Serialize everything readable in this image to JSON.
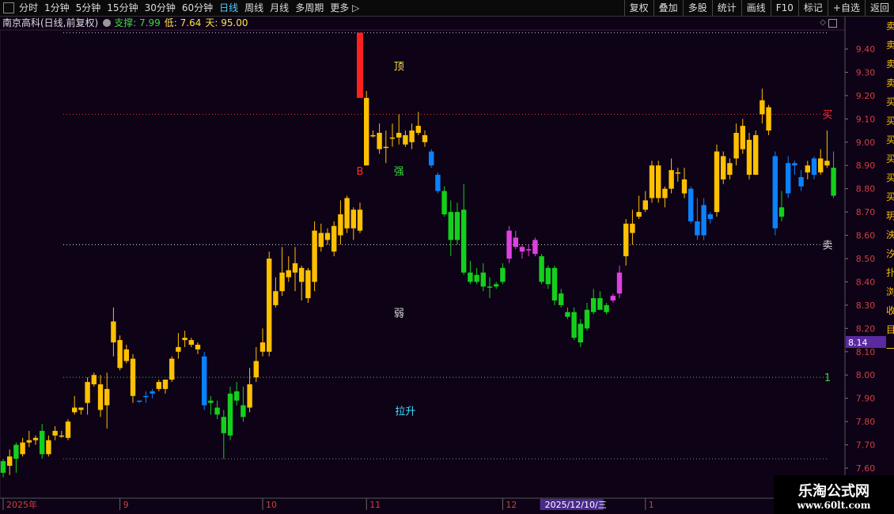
{
  "toolbar": {
    "periods": [
      "分时",
      "1分钟",
      "5分钟",
      "15分钟",
      "30分钟",
      "60分钟",
      "日线",
      "周线",
      "月线",
      "多周期",
      "更多 ▷"
    ],
    "active_index": 6,
    "buttons": [
      "复权",
      "叠加",
      "多股",
      "统计",
      "画线",
      "F10",
      "标记",
      "+自选",
      "返回"
    ]
  },
  "info": {
    "stock_name": "南京高科(日线,前复权)",
    "support": "支撑: 7.99",
    "low": "低: 7.64",
    "days": "天: 95.00"
  },
  "right_strip": [
    "卖",
    "卖",
    "卖",
    "卖",
    "买",
    "买",
    "买",
    "买",
    "买",
    "买",
    "玥",
    "泱",
    "汐",
    "扑",
    "浏",
    "收",
    "目",
    "一"
  ],
  "watermark": {
    "line1": "乐淘公式网",
    "line2": "www.60lt.com"
  },
  "colors": {
    "up": "#ffc000",
    "down": "#14d01c",
    "blue": "#0a82ff",
    "magenta": "#e040e0",
    "red": "#ff2020",
    "bg": "#0d0216"
  },
  "chart_data": {
    "type": "candlestick",
    "ylim": [
      7.55,
      9.47
    ],
    "y_ticks": [
      "9.40",
      "9.30",
      "9.20",
      "9.10",
      "9.00",
      "8.90",
      "8.80",
      "8.70",
      "8.60",
      "8.50",
      "8.40",
      "8.30",
      "8.20",
      "8.10",
      "8.00",
      "7.90",
      "7.80",
      "7.70",
      "7.60"
    ],
    "current_price_label": "8.14",
    "current_price": 8.14,
    "x_labels": [
      {
        "label": "2025年",
        "index": 0
      },
      {
        "label": "9",
        "index": 18
      },
      {
        "label": "10",
        "index": 40
      },
      {
        "label": "11",
        "index": 56
      },
      {
        "label": "12",
        "index": 77
      },
      {
        "label": "2025/12/10/三",
        "index": 83,
        "highlight": true
      },
      {
        "label": "1",
        "index": 99
      },
      {
        "label": "2",
        "index": 119
      }
    ],
    "hlines": [
      {
        "value": 9.47,
        "color": "#cccccc",
        "label": ""
      },
      {
        "value": 9.12,
        "color": "#ff3030",
        "label": "买"
      },
      {
        "value": 8.56,
        "color": "#dddddd",
        "label": "卖"
      },
      {
        "value": 7.99,
        "color": "#40d040",
        "label": "1"
      },
      {
        "value": 7.64,
        "color": "#888888",
        "label": ""
      }
    ],
    "annotations": [
      {
        "text": "顶",
        "index": 61,
        "value": 9.31,
        "color": "#ffe24a"
      },
      {
        "text": "强",
        "index": 61,
        "value": 8.86,
        "color": "#3cdc3c"
      },
      {
        "text": "弱",
        "index": 61,
        "value": 8.25,
        "color": "#dddddd"
      },
      {
        "text": "拉升",
        "index": 62,
        "value": 7.83,
        "color": "#40e0ff"
      },
      {
        "text": "B",
        "index": 55,
        "value": 8.86,
        "color": "#ff3030"
      }
    ],
    "spike": {
      "index": 55,
      "top": 9.47,
      "mid": 9.19,
      "bottom": 8.9
    },
    "candles": [
      [
        7.58,
        7.63,
        7.64,
        7.56,
        "g"
      ],
      [
        7.61,
        7.65,
        7.68,
        7.57,
        "y"
      ],
      [
        7.7,
        7.64,
        7.71,
        7.58,
        "g"
      ],
      [
        7.66,
        7.71,
        7.73,
        7.65,
        "y"
      ],
      [
        7.71,
        7.72,
        7.76,
        7.69,
        "y"
      ],
      [
        7.72,
        7.73,
        7.74,
        7.7,
        "y"
      ],
      [
        7.76,
        7.66,
        7.79,
        7.64,
        "g"
      ],
      [
        7.66,
        7.72,
        7.74,
        7.65,
        "y"
      ],
      [
        7.74,
        7.76,
        7.78,
        7.72,
        "y"
      ],
      [
        7.74,
        7.74,
        7.76,
        7.73,
        "y"
      ],
      [
        7.73,
        7.8,
        7.81,
        7.72,
        "y"
      ],
      [
        7.84,
        7.86,
        7.91,
        7.83,
        "y"
      ],
      [
        7.85,
        7.86,
        7.86,
        7.83,
        "y"
      ],
      [
        7.88,
        7.97,
        7.99,
        7.83,
        "y"
      ],
      [
        7.96,
        8.0,
        8.01,
        7.95,
        "y"
      ],
      [
        7.96,
        7.85,
        8.0,
        7.82,
        "y"
      ],
      [
        7.87,
        7.94,
        8.01,
        7.77,
        "y"
      ],
      [
        8.14,
        8.23,
        8.29,
        8.08,
        "y"
      ],
      [
        8.03,
        8.15,
        8.17,
        8.02,
        "y"
      ],
      [
        8.11,
        8.06,
        8.13,
        8.05,
        "y"
      ],
      [
        8.07,
        7.91,
        8.09,
        7.88,
        "y"
      ],
      [
        7.89,
        7.89,
        7.89,
        7.88,
        "b"
      ],
      [
        7.91,
        7.91,
        7.93,
        7.88,
        "b"
      ],
      [
        7.92,
        7.93,
        7.94,
        7.9,
        "b"
      ],
      [
        7.94,
        7.97,
        7.98,
        7.93,
        "y"
      ],
      [
        7.94,
        7.98,
        7.98,
        7.92,
        "y"
      ],
      [
        7.98,
        8.07,
        8.08,
        7.97,
        "y"
      ],
      [
        8.12,
        8.1,
        8.18,
        8.07,
        "y"
      ],
      [
        8.15,
        8.16,
        8.19,
        8.12,
        "y"
      ],
      [
        8.13,
        8.15,
        8.16,
        8.12,
        "y"
      ],
      [
        8.11,
        8.13,
        8.14,
        8.09,
        "y"
      ],
      [
        8.08,
        7.87,
        8.1,
        7.85,
        "b"
      ],
      [
        7.88,
        7.89,
        7.91,
        7.83,
        "g"
      ],
      [
        7.86,
        7.83,
        7.89,
        7.81,
        "g"
      ],
      [
        7.82,
        7.75,
        7.85,
        7.64,
        "g"
      ],
      [
        7.74,
        7.92,
        7.95,
        7.72,
        "g"
      ],
      [
        7.93,
        7.89,
        7.97,
        7.87,
        "g"
      ],
      [
        7.87,
        7.82,
        7.95,
        7.8,
        "g"
      ],
      [
        7.86,
        7.96,
        8.03,
        7.84,
        "y"
      ],
      [
        7.99,
        8.06,
        8.12,
        7.97,
        "y"
      ],
      [
        8.1,
        8.14,
        8.2,
        8.08,
        "y"
      ],
      [
        8.1,
        8.5,
        8.53,
        8.08,
        "y"
      ],
      [
        8.3,
        8.36,
        8.42,
        8.29,
        "y"
      ],
      [
        8.36,
        8.44,
        8.55,
        8.34,
        "y"
      ],
      [
        8.42,
        8.45,
        8.51,
        8.4,
        "y"
      ],
      [
        8.44,
        8.48,
        8.55,
        8.36,
        "y"
      ],
      [
        8.46,
        8.4,
        8.47,
        8.32,
        "y"
      ],
      [
        8.33,
        8.45,
        8.46,
        8.31,
        "y"
      ],
      [
        8.4,
        8.62,
        8.66,
        8.36,
        "y"
      ],
      [
        8.55,
        8.61,
        8.65,
        8.53,
        "y"
      ],
      [
        8.58,
        8.61,
        8.63,
        8.56,
        "y"
      ],
      [
        8.53,
        8.64,
        8.66,
        8.51,
        "y"
      ],
      [
        8.6,
        8.69,
        8.75,
        8.56,
        "y"
      ],
      [
        8.63,
        8.76,
        8.77,
        8.61,
        "y"
      ],
      [
        8.63,
        8.71,
        8.72,
        8.58,
        "y"
      ],
      [
        8.62,
        8.71,
        8.74,
        8.61,
        "y"
      ],
      [
        8.9,
        9.19,
        9.22,
        8.9,
        "y"
      ],
      [
        9.03,
        9.03,
        9.05,
        9.02,
        "y"
      ],
      [
        8.97,
        9.04,
        9.08,
        8.95,
        "y"
      ],
      [
        8.98,
        8.98,
        9.05,
        8.91,
        "y"
      ],
      [
        9.02,
        9.02,
        9.08,
        8.98,
        "y"
      ],
      [
        9.02,
        9.04,
        9.12,
        8.99,
        "y"
      ],
      [
        8.99,
        9.03,
        9.05,
        8.98,
        "y"
      ],
      [
        9.0,
        9.05,
        9.08,
        8.97,
        "y"
      ],
      [
        9.04,
        9.07,
        9.13,
        9.03,
        "y"
      ],
      [
        9.03,
        9.0,
        9.05,
        8.98,
        "y"
      ],
      [
        8.96,
        8.9,
        8.97,
        8.89,
        "b"
      ],
      [
        8.86,
        8.79,
        8.87,
        8.78,
        "b"
      ],
      [
        8.79,
        8.69,
        8.81,
        8.68,
        "g"
      ],
      [
        8.7,
        8.58,
        8.75,
        8.51,
        "g"
      ],
      [
        8.7,
        8.58,
        8.74,
        8.56,
        "g"
      ],
      [
        8.71,
        8.44,
        8.82,
        8.43,
        "g"
      ],
      [
        8.44,
        8.4,
        8.49,
        8.39,
        "g"
      ],
      [
        8.43,
        8.4,
        8.46,
        8.39,
        "g"
      ],
      [
        8.44,
        8.38,
        8.48,
        8.36,
        "g"
      ],
      [
        8.38,
        8.38,
        8.42,
        8.33,
        "g"
      ],
      [
        8.38,
        8.39,
        8.4,
        8.37,
        "g"
      ],
      [
        8.4,
        8.46,
        8.48,
        8.39,
        "g"
      ],
      [
        8.5,
        8.62,
        8.64,
        8.48,
        "m"
      ],
      [
        8.55,
        8.59,
        8.62,
        8.54,
        "m"
      ],
      [
        8.53,
        8.55,
        8.56,
        8.5,
        "m"
      ],
      [
        8.54,
        8.54,
        8.56,
        8.51,
        "m"
      ],
      [
        8.52,
        8.58,
        8.59,
        8.51,
        "m"
      ],
      [
        8.51,
        8.4,
        8.52,
        8.39,
        "g"
      ],
      [
        8.46,
        8.39,
        8.47,
        8.37,
        "g"
      ],
      [
        8.46,
        8.32,
        8.47,
        8.3,
        "g"
      ],
      [
        8.35,
        8.3,
        8.37,
        8.29,
        "g"
      ],
      [
        8.27,
        8.25,
        8.29,
        8.24,
        "g"
      ],
      [
        8.27,
        8.16,
        8.29,
        8.15,
        "g"
      ],
      [
        8.22,
        8.14,
        8.24,
        8.12,
        "g"
      ],
      [
        8.2,
        8.28,
        8.31,
        8.19,
        "g"
      ],
      [
        8.27,
        8.33,
        8.37,
        8.26,
        "g"
      ],
      [
        8.28,
        8.33,
        8.36,
        8.28,
        "g"
      ],
      [
        8.27,
        8.3,
        8.31,
        8.26,
        "g"
      ],
      [
        8.32,
        8.34,
        8.35,
        8.31,
        "m"
      ],
      [
        8.35,
        8.44,
        8.47,
        8.33,
        "m"
      ],
      [
        8.51,
        8.65,
        8.67,
        8.47,
        "y"
      ],
      [
        8.61,
        8.65,
        8.71,
        8.56,
        "y"
      ],
      [
        8.68,
        8.7,
        8.77,
        8.67,
        "y"
      ],
      [
        8.71,
        8.75,
        8.79,
        8.7,
        "y"
      ],
      [
        8.76,
        8.9,
        8.92,
        8.74,
        "y"
      ],
      [
        8.9,
        8.76,
        8.92,
        8.74,
        "y"
      ],
      [
        8.76,
        8.8,
        8.81,
        8.72,
        "y"
      ],
      [
        8.8,
        8.88,
        8.93,
        8.78,
        "y"
      ],
      [
        8.87,
        8.87,
        8.89,
        8.83,
        "y"
      ],
      [
        8.84,
        8.78,
        8.89,
        8.76,
        "y"
      ],
      [
        8.8,
        8.66,
        8.81,
        8.65,
        "b"
      ],
      [
        8.66,
        8.6,
        8.76,
        8.58,
        "b"
      ],
      [
        8.73,
        8.6,
        8.76,
        8.58,
        "b"
      ],
      [
        8.67,
        8.69,
        8.7,
        8.65,
        "b"
      ],
      [
        8.7,
        8.96,
        8.99,
        8.68,
        "y"
      ],
      [
        8.94,
        8.84,
        8.96,
        8.82,
        "y"
      ],
      [
        8.91,
        8.86,
        8.93,
        8.84,
        "y"
      ],
      [
        8.93,
        9.04,
        9.08,
        8.9,
        "y"
      ],
      [
        8.97,
        9.07,
        9.1,
        8.95,
        "y"
      ],
      [
        9.01,
        8.86,
        9.04,
        8.84,
        "y"
      ],
      [
        8.86,
        9.03,
        9.05,
        8.86,
        "y"
      ],
      [
        9.12,
        9.18,
        9.23,
        9.08,
        "y"
      ],
      [
        9.15,
        9.05,
        9.16,
        9.03,
        "y"
      ],
      [
        8.94,
        8.63,
        8.96,
        8.6,
        "b"
      ],
      [
        8.72,
        8.68,
        8.79,
        8.66,
        "g"
      ],
      [
        8.91,
        8.78,
        8.94,
        8.76,
        "b"
      ],
      [
        8.91,
        8.9,
        8.92,
        8.86,
        "b"
      ],
      [
        8.85,
        8.81,
        8.88,
        8.79,
        "b"
      ],
      [
        8.87,
        8.9,
        8.92,
        8.84,
        "y"
      ],
      [
        8.93,
        8.86,
        8.94,
        8.84,
        "b"
      ],
      [
        8.87,
        8.93,
        8.97,
        8.86,
        "y"
      ],
      [
        8.9,
        8.92,
        9.05,
        8.89,
        "y"
      ],
      [
        8.89,
        8.77,
        8.96,
        8.76,
        "g"
      ]
    ]
  }
}
